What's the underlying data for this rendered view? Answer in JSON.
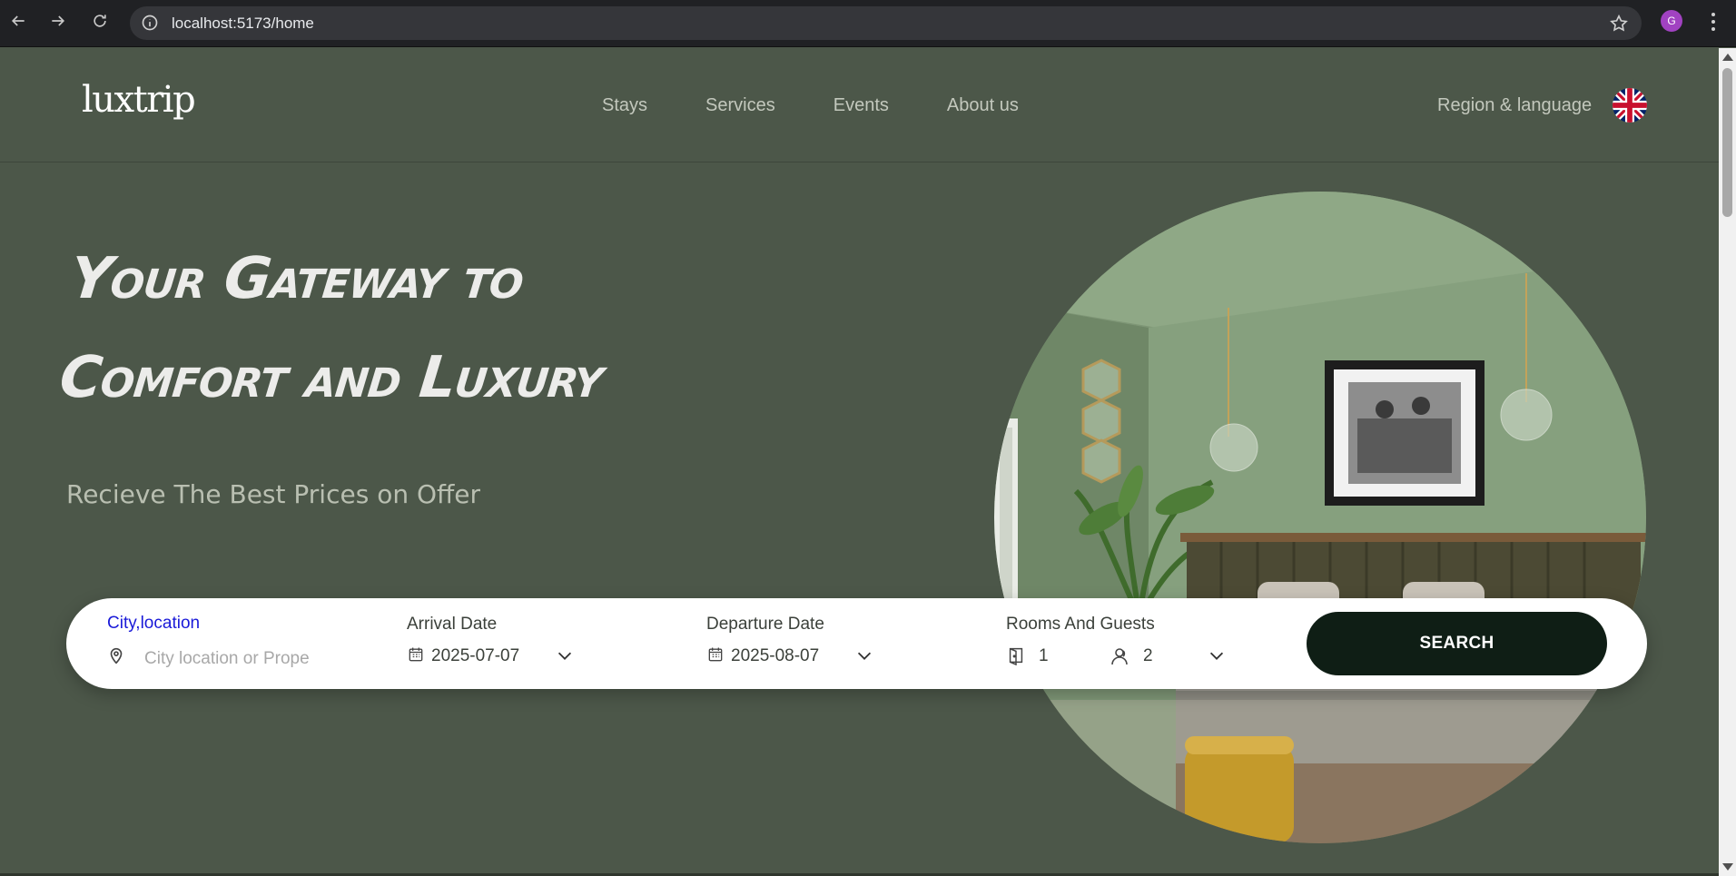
{
  "browser": {
    "url": "localhost:5173/home",
    "profile_initial": "G"
  },
  "header": {
    "logo": "luxtrip",
    "nav": [
      "Stays",
      "Services",
      "Events",
      "About us"
    ],
    "region_label": "Region & language",
    "flag": "uk-flag-icon"
  },
  "hero": {
    "title_line1": "Your Gateway to",
    "title_line2": "Comfort and Luxury",
    "subtitle": "Recieve The Best Prices on Offer"
  },
  "search": {
    "city_label": "City,location",
    "city_placeholder": "City location or Prope",
    "arrival_label": "Arrival Date",
    "arrival_value": "2025-07-07",
    "departure_label": "Departure Date",
    "departure_value": "2025-08-07",
    "rooms_guests_label": "Rooms And Guests",
    "rooms_value": "1",
    "guests_value": "2",
    "button_label": "SEARCH",
    "label_accent_color": "#1a1ad8",
    "button_color": "#0f1e15"
  },
  "colors": {
    "page_background": "#4c5749"
  }
}
